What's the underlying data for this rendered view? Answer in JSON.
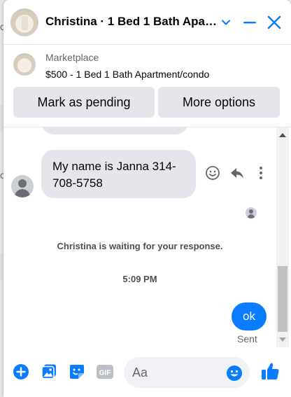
{
  "header": {
    "title": "Christina · 1 Bed 1 Bath Apartment/condo"
  },
  "marketplace": {
    "label": "Marketplace",
    "item": "$500 - 1 Bed 1 Bath Apartment/condo",
    "buttons": {
      "mark_pending": "Mark as pending",
      "more_options": "More options"
    }
  },
  "thread": {
    "incoming": [
      {
        "text": "My name is Janna 314-708-5758"
      }
    ],
    "status": "Christina is waiting for your response.",
    "timestamp": "5:09 PM",
    "outgoing": [
      {
        "text": "ok",
        "status": "Sent"
      }
    ]
  },
  "composer": {
    "placeholder": "Aa"
  },
  "colors": {
    "accent": "#0a7cff",
    "bubble_in": "#e4e6eb"
  },
  "icons": [
    "chevron-down-icon",
    "minimize-icon",
    "close-icon",
    "emoji-icon",
    "reply-icon",
    "more-icon",
    "plus-icon",
    "photo-icon",
    "sticker-icon",
    "gif-icon",
    "like-icon"
  ]
}
